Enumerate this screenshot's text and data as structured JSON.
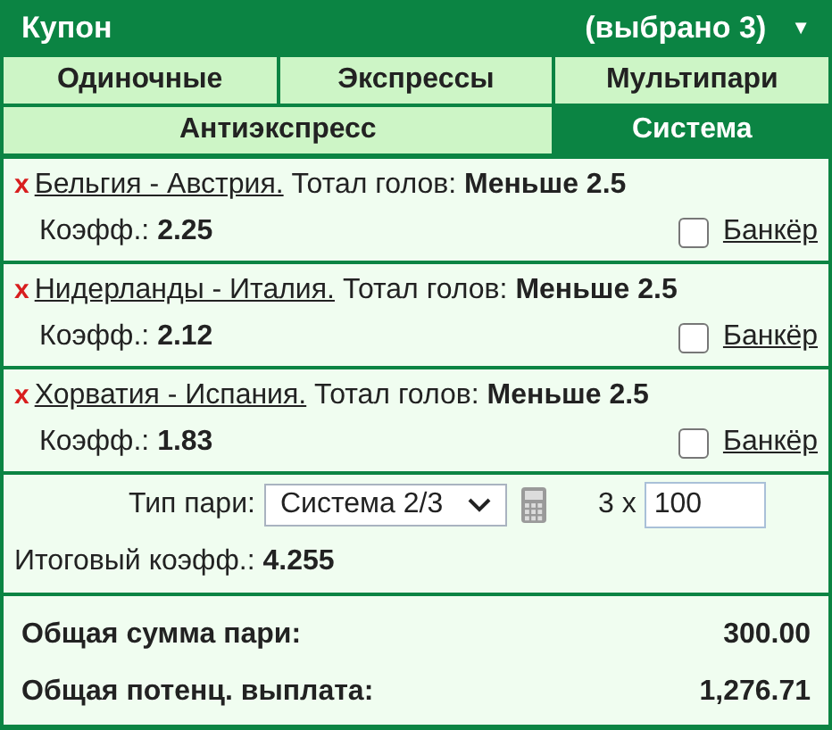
{
  "header": {
    "title": "Купон",
    "count": "(выбрано 3)",
    "collapse": "▼"
  },
  "tab_rows": [
    [
      {
        "label": "Одиночные",
        "selected": false
      },
      {
        "label": "Экспрессы",
        "selected": false
      },
      {
        "label": "Мультипари",
        "selected": false
      }
    ],
    [
      {
        "label": "Антиэкспресс",
        "selected": false
      },
      {
        "label": "Система",
        "selected": true
      }
    ]
  ],
  "bets": [
    {
      "remove": "x",
      "match": "Бельгия - Австрия.",
      "market": "Тотал голов:",
      "selection": "Меньше 2.5",
      "odds_label": "Коэфф.:",
      "odds": "2.25",
      "banker_checked": false,
      "banker_label": "Банкёр"
    },
    {
      "remove": "x",
      "match": "Нидерланды - Италия.",
      "market": "Тотал голов:",
      "selection": "Меньше 2.5",
      "odds_label": "Коэфф.:",
      "odds": "2.12",
      "banker_checked": false,
      "banker_label": "Банкёр"
    },
    {
      "remove": "x",
      "match": "Хорватия - Испания.",
      "market": "Тотал голов:",
      "selection": "Меньше 2.5",
      "odds_label": "Коэфф.:",
      "odds": "1.83",
      "banker_checked": false,
      "banker_label": "Банкёр"
    }
  ],
  "system": {
    "type_label": "Тип пари:",
    "type_value": "Система 2/3",
    "multiplier": "3 x",
    "stake": "100",
    "total_odds_label": "Итоговый коэфф.:",
    "total_odds": "4.255"
  },
  "totals": [
    {
      "label": "Общая сумма пари:",
      "value": "300.00"
    },
    {
      "label": "Общая потенц. выплата:",
      "value": "1,276.71"
    }
  ]
}
